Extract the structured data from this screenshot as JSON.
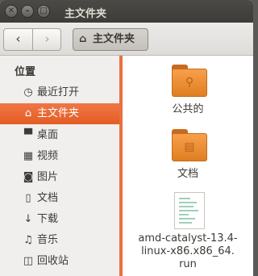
{
  "window": {
    "title": "主文件夹",
    "buttons": {
      "close": "✕",
      "minimize": "–",
      "maximize": "□"
    }
  },
  "toolbar": {
    "back_icon": "chevron-left",
    "forward_icon": "chevron-right",
    "breadcrumb": {
      "icon": "home-icon",
      "label": "主文件夹"
    }
  },
  "sidebar": {
    "heading": "位置",
    "items": [
      {
        "label": "最近打开",
        "icon": "clock-icon",
        "selected": false
      },
      {
        "label": "主文件夹",
        "icon": "home-icon",
        "selected": true
      },
      {
        "label": "桌面",
        "icon": "desktop-icon",
        "selected": false
      },
      {
        "label": "视频",
        "icon": "film-icon",
        "selected": false
      },
      {
        "label": "图片",
        "icon": "camera-icon",
        "selected": false
      },
      {
        "label": "文档",
        "icon": "document-icon",
        "selected": false
      },
      {
        "label": "下载",
        "icon": "download-icon",
        "selected": false
      },
      {
        "label": "音乐",
        "icon": "music-icon",
        "selected": false
      },
      {
        "label": "回收站",
        "icon": "trash-icon",
        "selected": false
      }
    ]
  },
  "files": [
    {
      "name": "公共的",
      "type": "folder",
      "icon": "share-folder-icon"
    },
    {
      "name": "文档",
      "type": "folder",
      "icon": "documents-folder-icon"
    },
    {
      "name_lines": [
        "amd-catalyst-13.4-",
        "linux-x86.x86_64.",
        "run"
      ],
      "type": "file",
      "icon": "script-file-icon"
    }
  ],
  "colors": {
    "accent": "#e9703f",
    "folder": "#f19a45",
    "titlebar": "#3c3b37"
  }
}
